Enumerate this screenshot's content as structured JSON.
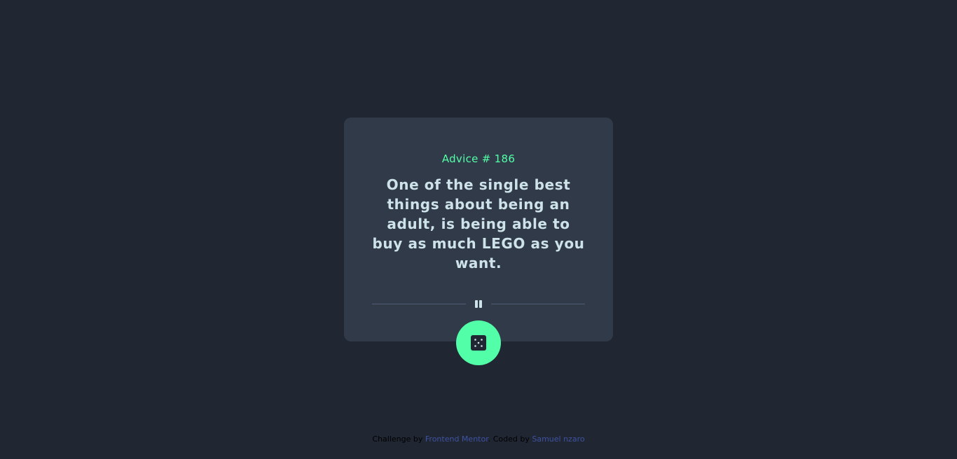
{
  "card": {
    "advice_id_label": "Advice # 186",
    "advice_text": "One of the single best things about being an adult, is being able to buy as much LEGO as you want."
  },
  "icons": {
    "divider": "pause-icon",
    "button": "dice-icon"
  },
  "attribution": {
    "challenge_prefix": "Challenge by",
    "challenge_link": "Frontend Mentor",
    "separator": ".",
    "coded_prefix": "Coded by",
    "coded_link": "Samuel nzaro"
  },
  "colors": {
    "background": "#202632",
    "card": "#313a49",
    "accent": "#52ffa8",
    "text": "#cee3e9",
    "divider": "#4f5d74",
    "link": "#3e52a3"
  }
}
